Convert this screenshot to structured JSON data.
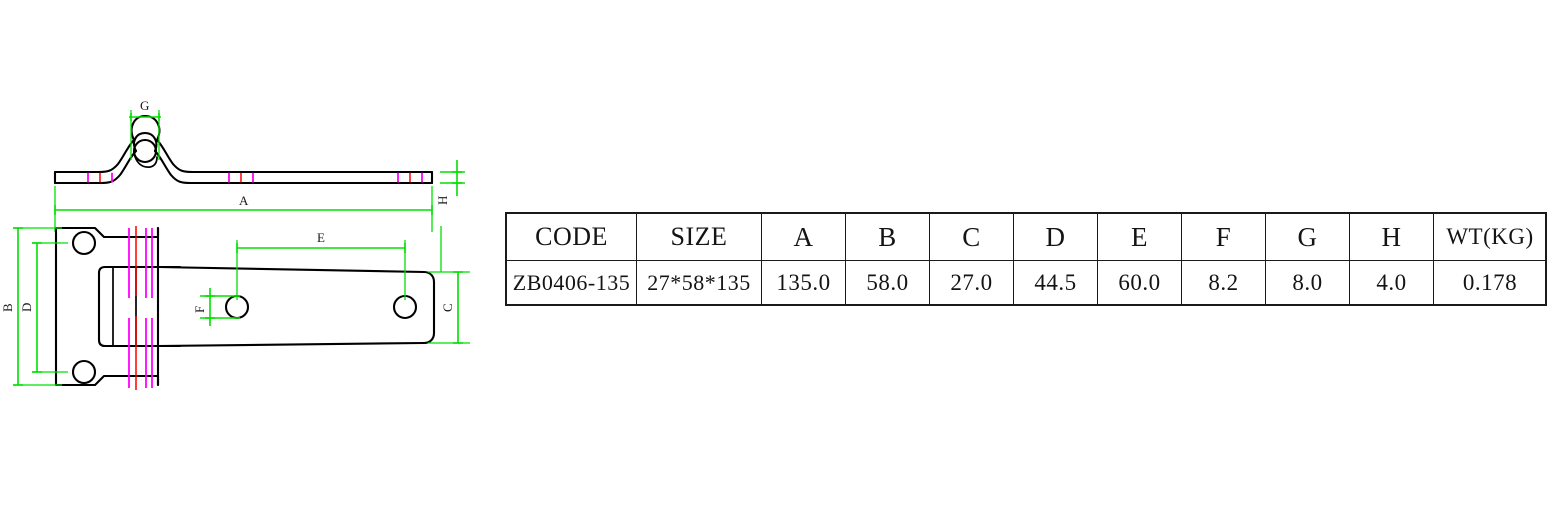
{
  "sheet": {
    "background_color": "#ffffff",
    "line_color": "#000000",
    "dimension_color": "#00e000",
    "centerline_color": "#ff0000",
    "hidden_color": "#ff00ff"
  },
  "views": {
    "side_view": {
      "name": "side-elevation-view",
      "description": "Side profile of strap hinge showing rolled knuckle"
    },
    "plan_view": {
      "name": "plan-view",
      "description": "Top plan view of strap hinge with mounting plate and tapered strap"
    }
  },
  "dimension_labels": {
    "a": "A",
    "b": "B",
    "c": "C",
    "d": "D",
    "e": "E",
    "f": "F",
    "g": "G",
    "h": "H"
  },
  "table": {
    "headers": [
      "CODE",
      "SIZE",
      "A",
      "B",
      "C",
      "D",
      "E",
      "F",
      "G",
      "H",
      "WT(KG)"
    ],
    "rows": [
      [
        "ZB0406-135",
        "27*58*135",
        "135.0",
        "58.0",
        "27.0",
        "44.5",
        "60.0",
        "8.2",
        "8.0",
        "4.0",
        "0.178"
      ]
    ]
  }
}
